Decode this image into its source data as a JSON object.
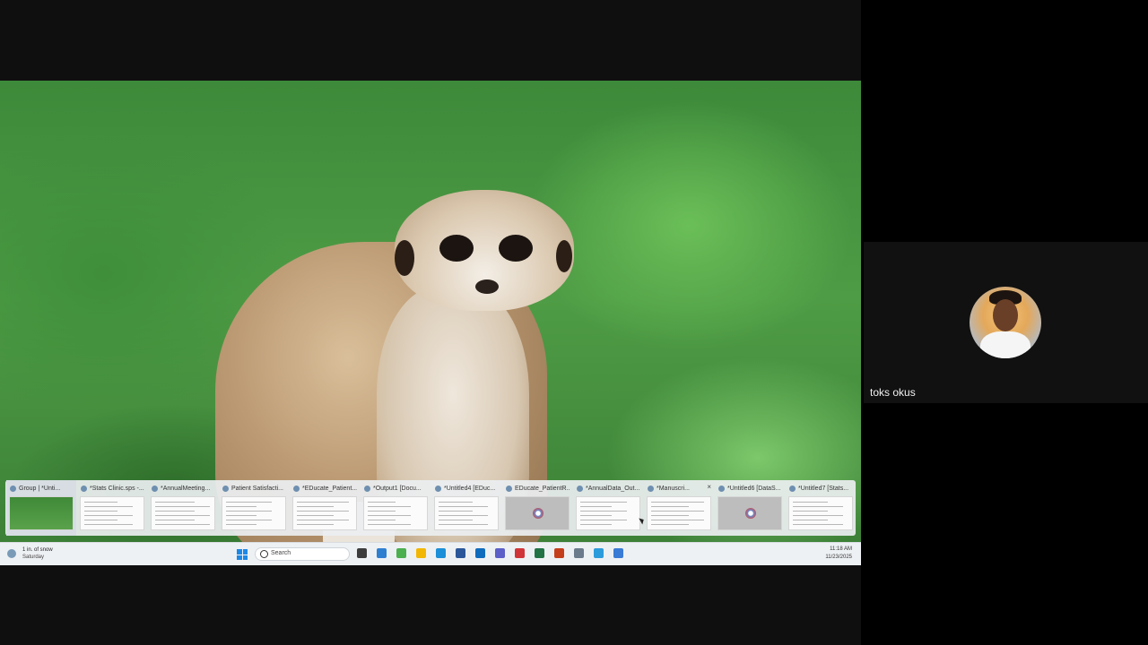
{
  "shared_screen": {
    "wallpaper": "meerkat-photo",
    "taskbar_preview": {
      "windows": [
        {
          "title": "Group | *Unti...",
          "preview": "photo",
          "active": true
        },
        {
          "title": "*Stats Clinic.sps -...",
          "preview": "document"
        },
        {
          "title": "*AnnualMeeting...",
          "preview": "document"
        },
        {
          "title": "Patient Satisfacti...",
          "preview": "document"
        },
        {
          "title": "*EDucate_Patient...",
          "preview": "document"
        },
        {
          "title": "*Output1 [Docu...",
          "preview": "document"
        },
        {
          "title": "*Untitled4 [EDuc...",
          "preview": "document"
        },
        {
          "title": "EDucate_PatientR...",
          "preview": "gray"
        },
        {
          "title": "*AnnualData_Out...",
          "preview": "document"
        },
        {
          "title": "*Manuscri...",
          "preview": "document",
          "close": "×"
        },
        {
          "title": "*Untitled6 [DataS...",
          "preview": "gray"
        },
        {
          "title": "*Untitled7 [Stats...",
          "preview": "document"
        }
      ]
    },
    "taskbar": {
      "weather_line1": "1 in. of snow",
      "weather_line2": "Saturday",
      "search_placeholder": "Search",
      "time": "11:18 AM",
      "date": "11/23/2025",
      "pinned_icons": [
        "file-explorer-icon",
        "widgets-icon",
        "chrome-icon",
        "folder-icon",
        "edge-icon",
        "word-icon",
        "outlook-icon",
        "teams-icon",
        "zotero-icon",
        "excel-icon",
        "powerpoint-icon",
        "calculator-icon",
        "photos-icon",
        "spss-icon"
      ]
    }
  },
  "participant": {
    "name": "toks okus"
  },
  "colors": {
    "accent": "#1e88e5",
    "panel_bg": "#000000",
    "tile_bg": "#111111"
  }
}
